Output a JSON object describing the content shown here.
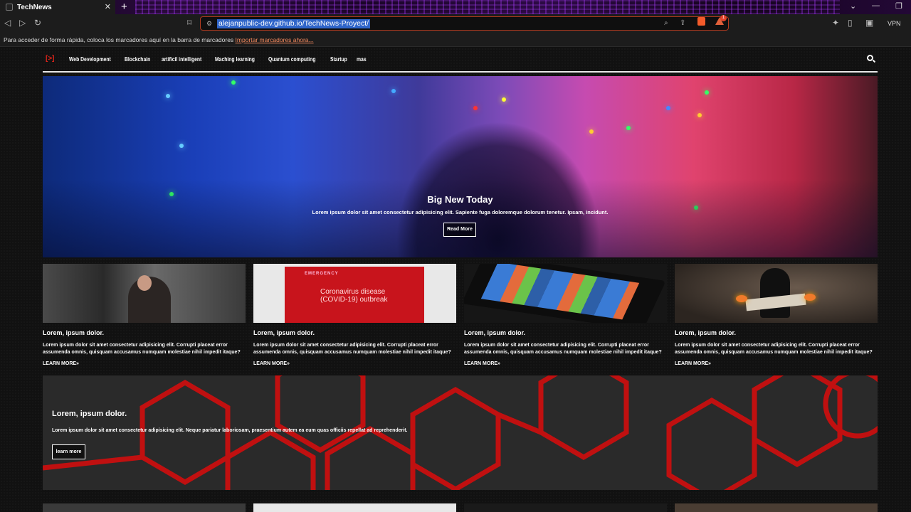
{
  "browser": {
    "tab_title": "TechNews",
    "tab_close": "✕",
    "new_tab": "+",
    "url": "alejanpublic-dev.github.io/TechNews-Proyect/",
    "vpn_label": "VPN",
    "rewards_count": "1",
    "bookmarks_text": "Para acceder de forma rápida, coloca los marcadores aquí en la barra de marcadores",
    "bookmarks_link": "Importar marcadores ahora..."
  },
  "nav": {
    "logo": "[>]",
    "links": [
      "Web Development",
      "Blockchain",
      "artificil intelligent",
      "Maching learning",
      "Quantum computing",
      "Startup",
      "mas"
    ]
  },
  "hero": {
    "title": "Big New Today",
    "text": "Lorem ipsum dolor sit amet consectetur adipisicing elit. Sapiente fuga doloremque dolorum tenetur. Ipsam, incidunt.",
    "button": "Read More"
  },
  "cards": [
    {
      "title": "Lorem, ipsum dolor.",
      "text": "Lorem ipsum dolor sit amet consectetur adipisicing elit. Corrupti placeat error assumenda omnis, quisquam accusamus numquam molestiae nihil impedit itaque?",
      "more": "LEARN MORE»",
      "emergency_label": ""
    },
    {
      "title": "Lorem, ipsum dolor.",
      "text": "Lorem ipsum dolor sit amet consectetur adipisicing elit. Corrupti placeat error assumenda omnis, quisquam accusamus numquam molestiae nihil impedit itaque?",
      "more": "LEARN MORE»",
      "emergency_label": "EMERGENCY",
      "covid_text": "Coronavirus disease (COVID-19) outbreak"
    },
    {
      "title": "Lorem, ipsum dolor.",
      "text": "Lorem ipsum dolor sit amet consectetur adipisicing elit. Corrupti placeat error assumenda omnis, quisquam accusamus numquam molestiae nihil impedit itaque?",
      "more": "LEARN MORE»",
      "emergency_label": ""
    },
    {
      "title": "Lorem, ipsum dolor.",
      "text": "Lorem ipsum dolor sit amet consectetur adipisicing elit. Corrupti placeat error assumenda omnis, quisquam accusamus numquam molestiae nihil impedit itaque?",
      "more": "LEARN MORE»",
      "emergency_label": ""
    }
  ],
  "promo": {
    "title": "Lorem, ipsum dolor.",
    "text": "Lorem ipsum dolor sit amet consectetur adipisicing elit. Neque pariatur laboriosam, praesentium autem ea eum quas officiis repellat ad reprehenderit.",
    "button": "learn more"
  },
  "colors": {
    "accent": "#e0241a",
    "address_border": "#b23a1f",
    "selection": "#2f65c9",
    "bookmark_link": "#f58a5f"
  }
}
